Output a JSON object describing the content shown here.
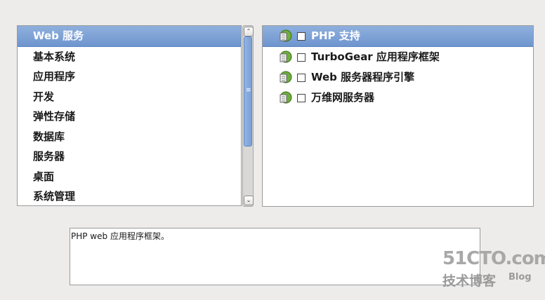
{
  "categories": {
    "items": [
      {
        "label": "Web 服务",
        "selected": true
      },
      {
        "label": "基本系统",
        "selected": false
      },
      {
        "label": "应用程序",
        "selected": false
      },
      {
        "label": "开发",
        "selected": false
      },
      {
        "label": "弹性存储",
        "selected": false
      },
      {
        "label": "数据库",
        "selected": false
      },
      {
        "label": "服务器",
        "selected": false
      },
      {
        "label": "桌面",
        "selected": false
      },
      {
        "label": "系统管理",
        "selected": false
      }
    ]
  },
  "scrollbar": {
    "up_glyph": "⌃",
    "down_glyph": "⌄",
    "grip_glyph": "≡"
  },
  "packages": {
    "icon": "package-group-icon",
    "items": [
      {
        "label": "PHP 支持",
        "checked": false,
        "selected": true
      },
      {
        "label": "TurboGear 应用程序框架",
        "checked": false,
        "selected": false
      },
      {
        "label": "Web 服务器程序引擎",
        "checked": false,
        "selected": false
      },
      {
        "label": "万维网服务器",
        "checked": false,
        "selected": false
      }
    ]
  },
  "description": {
    "text": "PHP web 应用程序框架。"
  },
  "watermark": {
    "main": "51CTO.com",
    "sub": "技术博客",
    "blog": "Blog"
  },
  "colors": {
    "selection": "#7aa0d6",
    "background": "#edeceb"
  }
}
